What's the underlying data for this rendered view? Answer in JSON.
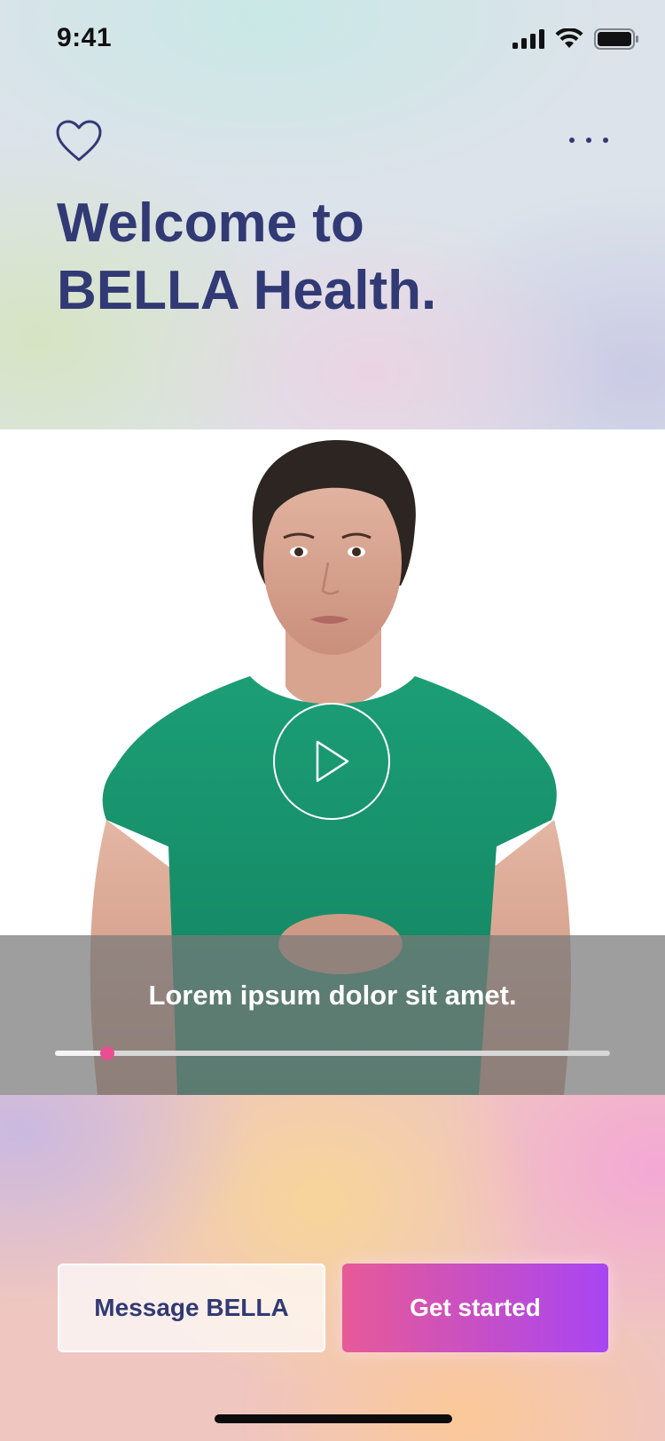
{
  "status_bar": {
    "time": "9:41",
    "icons": [
      "signal-icon",
      "wifi-icon",
      "battery-icon"
    ]
  },
  "top_nav": {
    "left_icon": "heart-icon",
    "right_icon": "more-icon"
  },
  "hero": {
    "title_line1": "Welcome to",
    "title_line2": "BELLA Health."
  },
  "video": {
    "play_icon": "play-icon",
    "caption": "Lorem ipsum dolor sit amet.",
    "progress": 0.095
  },
  "actions": {
    "secondary_label": "Message BELLA",
    "primary_label": "Get started"
  },
  "colors": {
    "title": "#313a74",
    "accent_start": "#e75a97",
    "accent_end": "#a845f3",
    "progress_thumb": "#e84f8f"
  }
}
